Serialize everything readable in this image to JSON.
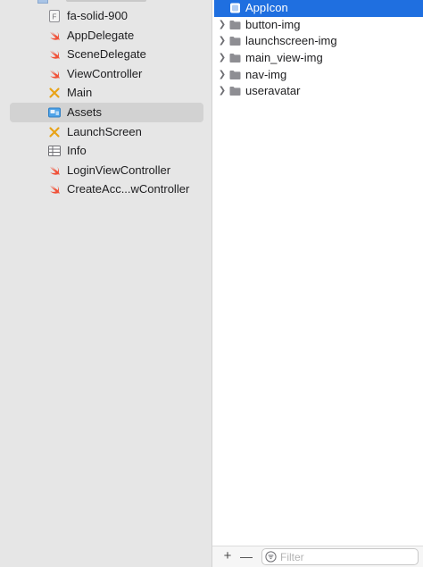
{
  "navigator": {
    "items": [
      {
        "label": "fa-solid-900",
        "icon": "font-file-icon"
      },
      {
        "label": "AppDelegate",
        "icon": "swift-icon"
      },
      {
        "label": "SceneDelegate",
        "icon": "swift-icon"
      },
      {
        "label": "ViewController",
        "icon": "swift-icon"
      },
      {
        "label": "Main",
        "icon": "storyboard-icon"
      },
      {
        "label": "Assets",
        "icon": "asset-catalog-icon",
        "selected": true
      },
      {
        "label": "LaunchScreen",
        "icon": "storyboard-icon"
      },
      {
        "label": "Info",
        "icon": "plist-icon"
      },
      {
        "label": "LoginViewController",
        "icon": "swift-icon"
      },
      {
        "label": "CreateAcc...wController",
        "icon": "swift-icon"
      }
    ]
  },
  "assets": {
    "items": [
      {
        "label": "AppIcon",
        "icon": "app-icon-set-icon",
        "selected": true
      },
      {
        "label": "button-img",
        "icon": "folder-icon"
      },
      {
        "label": "launchscreen-img",
        "icon": "folder-icon"
      },
      {
        "label": "main_view-img",
        "icon": "folder-icon"
      },
      {
        "label": "nav-img",
        "icon": "folder-icon"
      },
      {
        "label": "useravatar",
        "icon": "folder-icon"
      }
    ]
  },
  "bottom_bar": {
    "add_label": "+",
    "remove_label": "—",
    "filter_placeholder": "Filter"
  },
  "colors": {
    "swift": "#f05138",
    "storyboard": "#e8a317",
    "selection": "#1f6fe0",
    "navigator_bg": "#e6e6e6"
  }
}
